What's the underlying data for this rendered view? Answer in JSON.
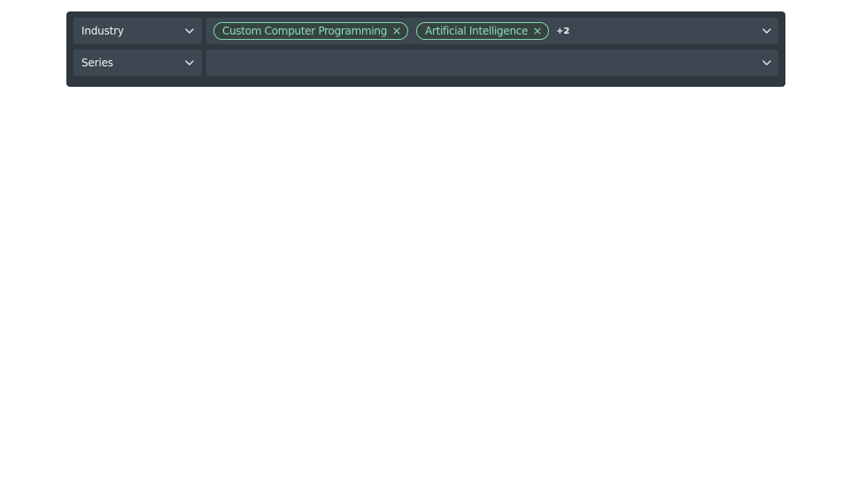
{
  "filters": {
    "rows": [
      {
        "field_label": "Industry",
        "tags": [
          {
            "label": "Custom Computer Programming"
          },
          {
            "label": "Artificial Intelligence"
          }
        ],
        "more_count": "+2"
      },
      {
        "field_label": "Series",
        "tags": [],
        "more_count": ""
      }
    ]
  },
  "colors": {
    "panel_bg": "#2f3740",
    "field_bg": "#3d4751",
    "tag_border": "#82d2b1",
    "tag_text": "#8fdcbc",
    "text": "#f1f4f6"
  },
  "icons": {
    "dropdown": "chevron-down-icon",
    "remove_tag": "close-icon"
  }
}
